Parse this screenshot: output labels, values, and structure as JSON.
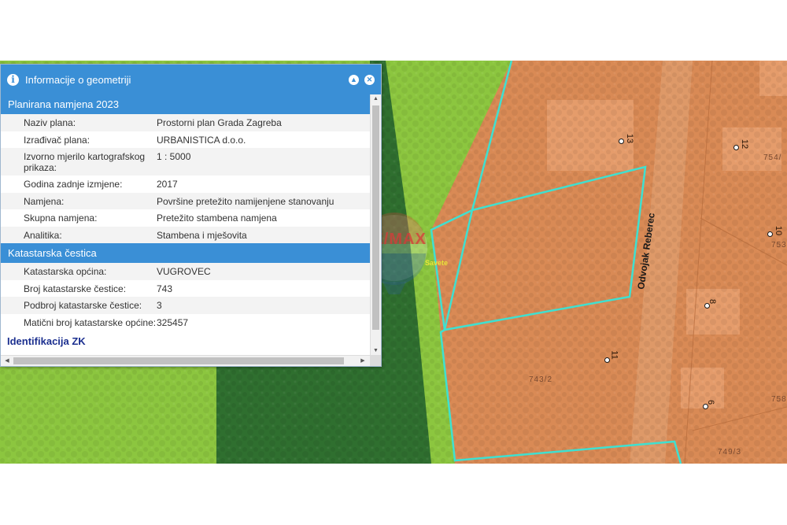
{
  "panel": {
    "title": "Informacije o geometriji",
    "sections": [
      {
        "title": "Planirana namjena 2023",
        "rows": [
          {
            "label": "Naziv plana:",
            "value": "Prostorni plan Grada Zagreba"
          },
          {
            "label": "Izrađivač plana:",
            "value": "URBANISTICA d.o.o."
          },
          {
            "label": "Izvorno mjerilo kartografskog prikaza:",
            "value": "1 : 5000"
          },
          {
            "label": "Godina zadnje izmjene:",
            "value": "2017"
          },
          {
            "label": "Namjena:",
            "value": "Površine pretežito namijenjene stanovanju"
          },
          {
            "label": "Skupna namjena:",
            "value": "Pretežito stambena namjena"
          },
          {
            "label": "Analitika:",
            "value": "Stambena i mješovita"
          }
        ]
      },
      {
        "title": "Katastarska čestica",
        "rows": [
          {
            "label": "Katastarska općina:",
            "value": "VUGROVEC"
          },
          {
            "label": "Broj katastarske čestice:",
            "value": "743"
          },
          {
            "label": "Podbroj katastarske čestice:",
            "value": "3"
          },
          {
            "label": "Matični broj katastarske općine:",
            "value": "325457"
          }
        ]
      }
    ],
    "link": "Identifikacija ZK",
    "icons": {
      "info": "info-icon",
      "collapse": "chevron-up-icon",
      "close": "close-icon"
    }
  },
  "map": {
    "street": "Odvojak Reberec",
    "house_numbers": [
      "13",
      "12",
      "10",
      "8",
      "11",
      "6"
    ],
    "parcel_numbers": [
      "754/",
      "753",
      "743/2",
      "758",
      "749/3"
    ],
    "colors": {
      "residential": "#d98a55",
      "green": "#8cc63f",
      "dark_green": "#2f6f2f",
      "parcel_outline": "#3fe0d0",
      "panel_header": "#3a8fd6"
    }
  },
  "watermark": {
    "logo": "RE/MAX",
    "tagline": "Savete"
  }
}
